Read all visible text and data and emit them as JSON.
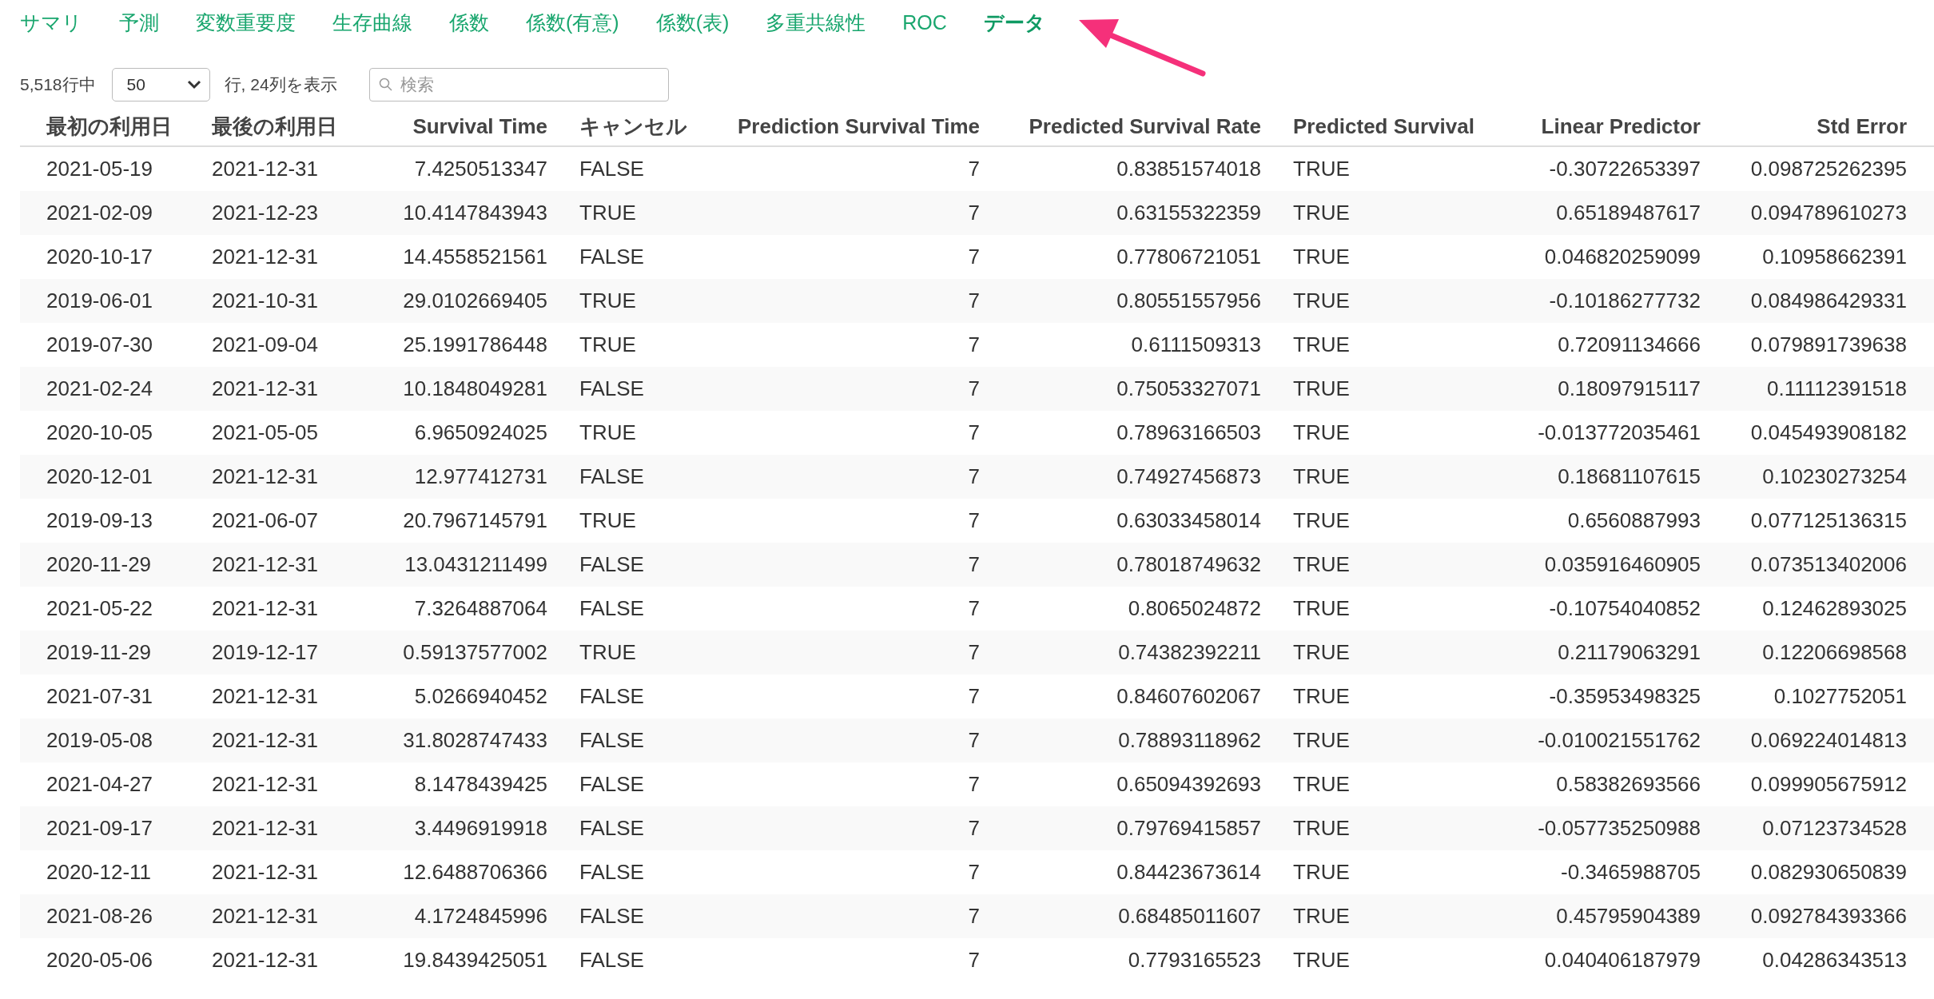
{
  "tabs": [
    {
      "label": "サマリ",
      "selected": false
    },
    {
      "label": "予測",
      "selected": false
    },
    {
      "label": "変数重要度",
      "selected": false
    },
    {
      "label": "生存曲線",
      "selected": false
    },
    {
      "label": "係数",
      "selected": false
    },
    {
      "label": "係数(有意)",
      "selected": false
    },
    {
      "label": "係数(表)",
      "selected": false
    },
    {
      "label": "多重共線性",
      "selected": false
    },
    {
      "label": "ROC",
      "selected": false
    },
    {
      "label": "データ",
      "selected": true
    }
  ],
  "controls": {
    "row_count": "5,518行中",
    "page_size": "50",
    "shown_info": "行, 24列を表示",
    "search": {
      "placeholder": "検索"
    }
  },
  "table": {
    "columns": [
      {
        "label": "最初の利用日",
        "kind": "text"
      },
      {
        "label": "最後の利用日",
        "kind": "text"
      },
      {
        "label": "Survival Time",
        "kind": "number"
      },
      {
        "label": "キャンセル",
        "kind": "text"
      },
      {
        "label": "Prediction Survival Time",
        "kind": "number"
      },
      {
        "label": "Predicted Survival Rate",
        "kind": "number"
      },
      {
        "label": "Predicted Survival",
        "kind": "text"
      },
      {
        "label": "Linear Predictor",
        "kind": "number"
      },
      {
        "label": "Std Error",
        "kind": "number"
      }
    ],
    "rows": [
      [
        "2021-05-19",
        "2021-12-31",
        "7.4250513347",
        "FALSE",
        "7",
        "0.83851574018",
        "TRUE",
        "-0.30722653397",
        "0.098725262395"
      ],
      [
        "2021-02-09",
        "2021-12-23",
        "10.4147843943",
        "TRUE",
        "7",
        "0.63155322359",
        "TRUE",
        "0.65189487617",
        "0.094789610273"
      ],
      [
        "2020-10-17",
        "2021-12-31",
        "14.4558521561",
        "FALSE",
        "7",
        "0.77806721051",
        "TRUE",
        "0.046820259099",
        "0.10958662391"
      ],
      [
        "2019-06-01",
        "2021-10-31",
        "29.0102669405",
        "TRUE",
        "7",
        "0.80551557956",
        "TRUE",
        "-0.10186277732",
        "0.084986429331"
      ],
      [
        "2019-07-30",
        "2021-09-04",
        "25.1991786448",
        "TRUE",
        "7",
        "0.6111509313",
        "TRUE",
        "0.72091134666",
        "0.079891739638"
      ],
      [
        "2021-02-24",
        "2021-12-31",
        "10.1848049281",
        "FALSE",
        "7",
        "0.75053327071",
        "TRUE",
        "0.18097915117",
        "0.11112391518"
      ],
      [
        "2020-10-05",
        "2021-05-05",
        "6.9650924025",
        "TRUE",
        "7",
        "0.78963166503",
        "TRUE",
        "-0.013772035461",
        "0.045493908182"
      ],
      [
        "2020-12-01",
        "2021-12-31",
        "12.977412731",
        "FALSE",
        "7",
        "0.74927456873",
        "TRUE",
        "0.18681107615",
        "0.10230273254"
      ],
      [
        "2019-09-13",
        "2021-06-07",
        "20.7967145791",
        "TRUE",
        "7",
        "0.63033458014",
        "TRUE",
        "0.6560887993",
        "0.077125136315"
      ],
      [
        "2020-11-29",
        "2021-12-31",
        "13.0431211499",
        "FALSE",
        "7",
        "0.78018749632",
        "TRUE",
        "0.035916460905",
        "0.073513402006"
      ],
      [
        "2021-05-22",
        "2021-12-31",
        "7.3264887064",
        "FALSE",
        "7",
        "0.8065024872",
        "TRUE",
        "-0.10754040852",
        "0.12462893025"
      ],
      [
        "2019-11-29",
        "2019-12-17",
        "0.59137577002",
        "TRUE",
        "7",
        "0.74382392211",
        "TRUE",
        "0.21179063291",
        "0.12206698568"
      ],
      [
        "2021-07-31",
        "2021-12-31",
        "5.0266940452",
        "FALSE",
        "7",
        "0.84607602067",
        "TRUE",
        "-0.35953498325",
        "0.1027752051"
      ],
      [
        "2019-05-08",
        "2021-12-31",
        "31.8028747433",
        "FALSE",
        "7",
        "0.78893118962",
        "TRUE",
        "-0.010021551762",
        "0.069224014813"
      ],
      [
        "2021-04-27",
        "2021-12-31",
        "8.1478439425",
        "FALSE",
        "7",
        "0.65094392693",
        "TRUE",
        "0.58382693566",
        "0.099905675912"
      ],
      [
        "2021-09-17",
        "2021-12-31",
        "3.4496919918",
        "FALSE",
        "7",
        "0.79769415857",
        "TRUE",
        "-0.057735250988",
        "0.07123734528"
      ],
      [
        "2020-12-11",
        "2021-12-31",
        "12.6488706366",
        "FALSE",
        "7",
        "0.84423673614",
        "TRUE",
        "-0.3465988705",
        "0.082930650839"
      ],
      [
        "2021-08-26",
        "2021-12-31",
        "4.1724845996",
        "FALSE",
        "7",
        "0.68485011607",
        "TRUE",
        "0.45795904389",
        "0.092784393366"
      ],
      [
        "2020-05-06",
        "2021-12-31",
        "19.8439425051",
        "FALSE",
        "7",
        "0.7793165523",
        "TRUE",
        "0.040406187979",
        "0.04286343513"
      ]
    ]
  }
}
